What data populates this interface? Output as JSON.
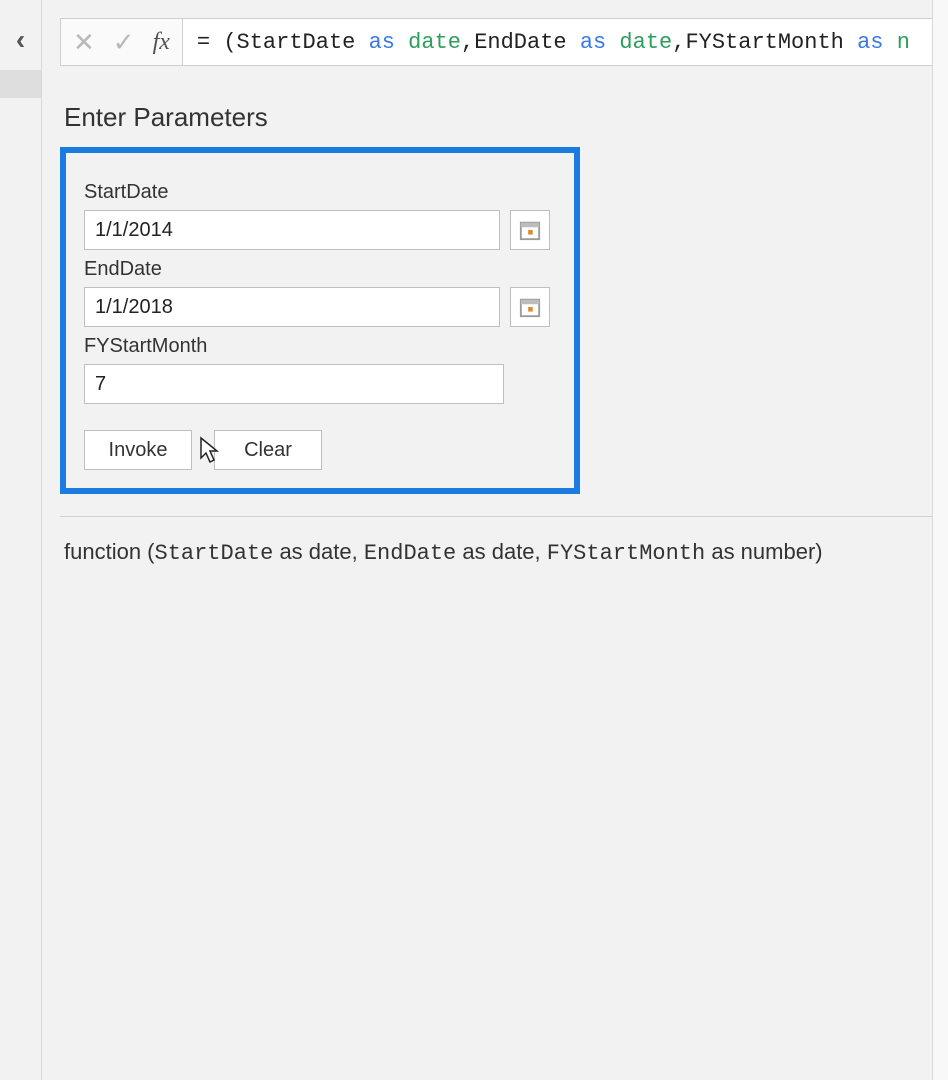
{
  "collapse_glyph": "‹",
  "formula": {
    "eq": "= (",
    "p1": "StartDate",
    "as": "as",
    "t_date": "date",
    "comma": ", ",
    "p2": "EndDate",
    "p3": "FYStartMonth",
    "tail": "n"
  },
  "section_title": "Enter Parameters",
  "fields": {
    "start": {
      "label": "StartDate",
      "value": "1/1/2014"
    },
    "end": {
      "label": "EndDate",
      "value": "1/1/2018"
    },
    "fym": {
      "label": "FYStartMonth",
      "value": "7"
    }
  },
  "buttons": {
    "invoke": "Invoke",
    "clear": "Clear"
  },
  "signature": {
    "fn": "function (",
    "p1": "StartDate",
    "asdate": " as date, ",
    "p2": "EndDate",
    "p3": "FYStartMonth",
    "asnum": " as number) "
  },
  "fx_label": "fx"
}
